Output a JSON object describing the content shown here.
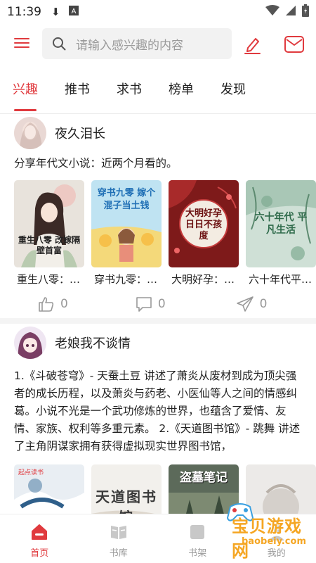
{
  "status_bar": {
    "time": "11:39"
  },
  "search": {
    "placeholder": "请输入感兴趣的内容"
  },
  "tabs": [
    {
      "label": "兴趣",
      "active": true
    },
    {
      "label": "推书"
    },
    {
      "label": "求书"
    },
    {
      "label": "榜单"
    },
    {
      "label": "发现"
    }
  ],
  "posts": [
    {
      "author": "夜久泪长",
      "text": "分享年代文小说：近两个月看的。",
      "books": [
        {
          "title": "重生八零：…",
          "cover_text": "重生八零 改嫁隔壁首富"
        },
        {
          "title": "穿书九零：…",
          "cover_text": "穿书九零 嫁个混子当土钱"
        },
        {
          "title": "大明好孕：…",
          "cover_text": "大明好孕 日日不孩度"
        },
        {
          "title": "六十年代平…",
          "cover_text": "六十年代 平凡生活"
        }
      ],
      "likes": "0",
      "comments": "0",
      "shares": "0"
    },
    {
      "author": "老娘我不谈情",
      "text": "1.《斗破苍穹》- 天蚕土豆 讲述了萧炎从废材到成为顶尖强者的成长历程，以及萧炎与药老、小医仙等人之间的情感纠葛。小说不光是一个武功修炼的世界，也蕴含了爱情、友情、家族、权利等多重元素。 2.《天道图书馆》- 跳舞 讲述了主角阴谋家拥有获得虚拟现实世界图书馆，",
      "books": [
        {
          "cover_text": "起点读书"
        },
        {
          "cover_text": "天道图书馆"
        },
        {
          "cover_text": "盗墓笔记"
        },
        {
          "cover_text": ""
        }
      ]
    }
  ],
  "bottom_nav": [
    {
      "label": "首页",
      "active": true
    },
    {
      "label": "书库"
    },
    {
      "label": "书架"
    },
    {
      "label": "我的"
    }
  ],
  "watermark": {
    "text": "宝贝游戏网",
    "url": "baobeiy.com"
  },
  "colors": {
    "accent": "#e03a3e",
    "watermark": "#f5a623"
  }
}
